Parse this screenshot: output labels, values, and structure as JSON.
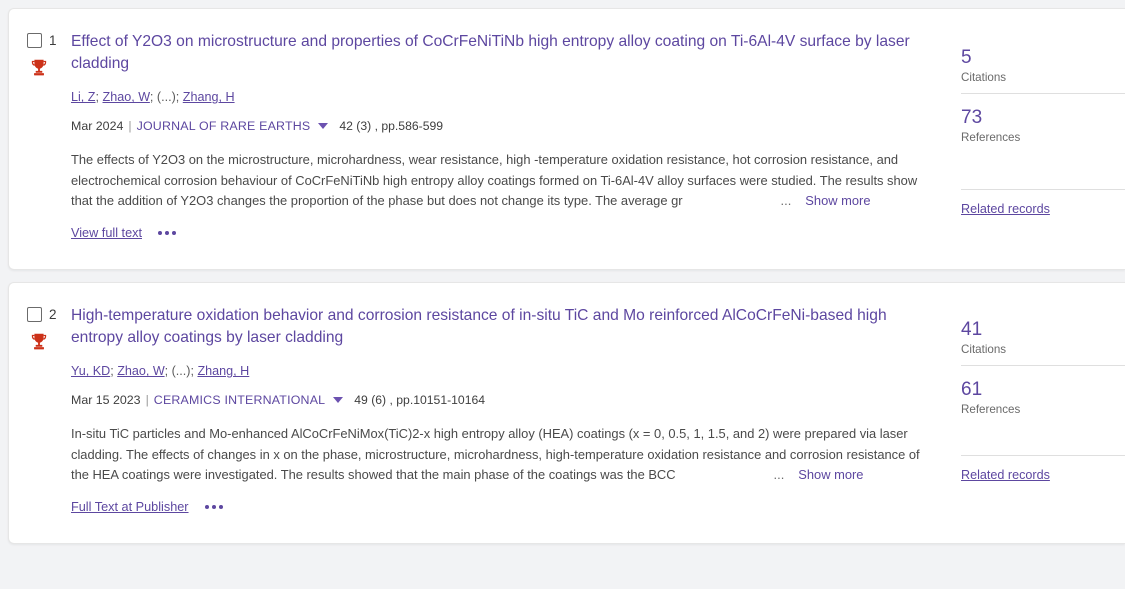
{
  "theme": {
    "accent_purple": "#5d47a0",
    "trophy_red": "#cc3118",
    "page_background": "#f2f3f5",
    "card_background": "#ffffff",
    "body_text": "#4a4a4a",
    "divider": "#dfdfdf"
  },
  "records": [
    {
      "rank": "1",
      "highly_cited_icon": "trophy-icon",
      "title": "Effect of Y2O3 on microstructure and properties of CoCrFeNiTiNb high entropy alloy coating on Ti-6Al-4V surface by laser cladding",
      "authors": [
        {
          "name": "Li, Z",
          "link": true
        },
        {
          "name": "Zhao, W",
          "link": true
        },
        {
          "name": "(...)",
          "link": false
        },
        {
          "name": "Zhang, H",
          "link": true
        }
      ],
      "authors_text": "Li, Z; Zhao, W; (...); Zhang, H",
      "date": "Mar 2024",
      "separator": "|",
      "journal": "JOURNAL OF RARE EARTHS",
      "journal_caret_icon": "chevron-down-icon",
      "volume_pages": "42 (3) , pp.586-599",
      "abstract": "The effects of Y2O3 on the microstructure, microhardness, wear resistance, high -temperature oxidation resistance, hot corrosion resistance, and electrochemical corrosion behaviour of CoCrFeNiTiNb high entropy alloy coatings formed on Ti-6Al-4V alloy surfaces were studied. The results show that the addition of Y2O3 changes the proportion of the phase but does not change its type. The average gr",
      "abstract_ellipsis": "...",
      "show_more_label": "Show more",
      "action_link": "View full text",
      "kebab_icon": "more-options-icon",
      "metrics": [
        {
          "value": "5",
          "label": "Citations"
        },
        {
          "value": "73",
          "label": "References"
        }
      ],
      "related_records_label": "Related records"
    },
    {
      "rank": "2",
      "highly_cited_icon": "trophy-icon",
      "title": "High-temperature oxidation behavior and corrosion resistance of in-situ TiC and Mo reinforced AlCoCrFeNi-based high entropy alloy coatings by laser cladding",
      "authors": [
        {
          "name": "Yu, KD",
          "link": true
        },
        {
          "name": "Zhao, W",
          "link": true
        },
        {
          "name": "(...)",
          "link": false
        },
        {
          "name": "Zhang, H",
          "link": true
        }
      ],
      "authors_text": "Yu, KD; Zhao, W; (...); Zhang, H",
      "date": "Mar 15 2023",
      "separator": "|",
      "journal": "CERAMICS INTERNATIONAL",
      "journal_caret_icon": "chevron-down-icon",
      "volume_pages": "49 (6) , pp.10151-10164",
      "abstract": "In-situ TiC particles and Mo-enhanced AlCoCrFeNiMox(TiC)2-x high entropy alloy (HEA) coatings (x = 0, 0.5, 1, 1.5, and 2) were prepared via laser cladding. The effects of changes in x on the phase, microstructure, microhardness, high-temperature oxidation resistance and corrosion resistance of the HEA coatings were investigated. The results showed that the main phase of the coatings was the BCC",
      "abstract_ellipsis": "...",
      "show_more_label": "Show more",
      "action_link": "Full Text at Publisher",
      "kebab_icon": "more-options-icon",
      "metrics": [
        {
          "value": "41",
          "label": "Citations"
        },
        {
          "value": "61",
          "label": "References"
        }
      ],
      "related_records_label": "Related records"
    }
  ]
}
